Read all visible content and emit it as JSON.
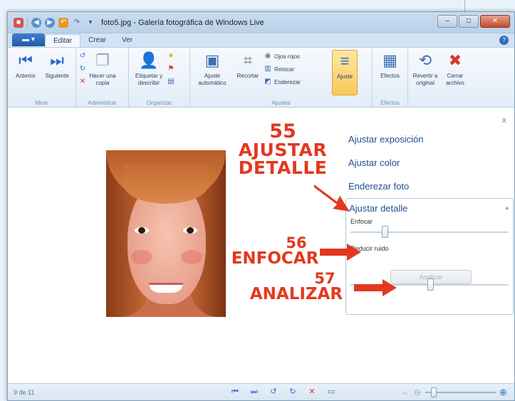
{
  "window": {
    "title": "foto5.jpg - Galería fotográfica de Windows Live"
  },
  "tabs": {
    "file_label": "",
    "items": [
      "Editar",
      "Crear",
      "Ver"
    ]
  },
  "ribbon": {
    "groups": {
      "browse": {
        "label": "Mirar",
        "prev": "Anterior",
        "next": "Siguiente"
      },
      "manage": {
        "label": "Administrar",
        "copy": "Hacer una copia"
      },
      "organize": {
        "label": "Organizar",
        "tag": "Etiquetar y describir"
      },
      "adjust": {
        "label": "Ajustes",
        "auto": "Ajuste automático",
        "crop": "Recortar",
        "redeye": "Ojos rojos",
        "retouch": "Retocar",
        "straighten": "Enderezar",
        "adjust": "Ajuste"
      },
      "effects": {
        "label": "Efectos",
        "effects": "Efectos"
      },
      "revert": {
        "revert": "Revertir a original",
        "close": "Cerrar archivo"
      }
    }
  },
  "panel": {
    "close": "x",
    "items": [
      "Ajustar exposición",
      "Ajustar color",
      "Enderezar foto"
    ],
    "detail": {
      "title": "Ajustar detalle",
      "sharpen_label": "Enfocar",
      "noise_label": "Reducir ruido",
      "analyze_button": "Analizar"
    }
  },
  "annotations": {
    "a55": {
      "num": "55",
      "line1": "AJUSTAR",
      "line2": "DETALLE"
    },
    "a56": {
      "num": "56",
      "text": "ENFOCAR"
    },
    "a57": {
      "num": "57",
      "text": "ANALIZAR"
    }
  },
  "statusbar": {
    "text": "9 de 11"
  },
  "colors": {
    "annotation": "#e3381f",
    "link": "#1f4f8e"
  }
}
